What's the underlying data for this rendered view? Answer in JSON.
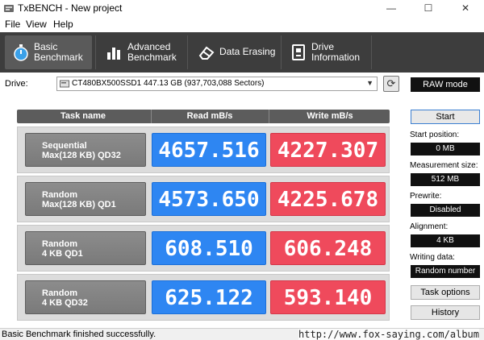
{
  "window": {
    "title": "TxBENCH - New project",
    "minimize": "—",
    "maximize": "☐",
    "close": "✕"
  },
  "menu": [
    "File",
    "View",
    "Help"
  ],
  "tabs": [
    {
      "label": "Basic\nBenchmark",
      "icon": "stopwatch-icon",
      "active": true
    },
    {
      "label": "Advanced\nBenchmark",
      "icon": "bar-chart-icon",
      "active": false
    },
    {
      "label": "Data Erasing",
      "icon": "eraser-icon",
      "active": false
    },
    {
      "label": "Drive\nInformation",
      "icon": "drive-info-icon",
      "active": false
    }
  ],
  "drive": {
    "label": "Drive:",
    "selected": "CT480BX500SSD1  447.13 GB (937,703,088 Sectors)"
  },
  "table": {
    "headers": [
      "Task name",
      "Read mB/s",
      "Write mB/s"
    ],
    "rows": [
      {
        "task_line1": "Sequential",
        "task_line2": "Max(128 KB) QD32",
        "read": "4657.516",
        "write": "4227.307"
      },
      {
        "task_line1": "Random",
        "task_line2": "Max(128 KB) QD1",
        "read": "4573.650",
        "write": "4225.678"
      },
      {
        "task_line1": "Random",
        "task_line2": "4 KB QD1",
        "read": "608.510",
        "write": "606.248"
      },
      {
        "task_line1": "Random",
        "task_line2": "4 KB QD32",
        "read": "625.122",
        "write": "593.140"
      }
    ]
  },
  "panel": {
    "raw_mode": "RAW mode",
    "start": "Start",
    "start_position_label": "Start position:",
    "start_position": "0 MB",
    "measurement_size_label": "Measurement size:",
    "measurement_size": "512 MB",
    "prewrite_label": "Prewrite:",
    "prewrite": "Disabled",
    "alignment_label": "Alignment:",
    "alignment": "4 KB",
    "writing_data_label": "Writing data:",
    "writing_data": "Random number",
    "task_options": "Task options",
    "history": "History"
  },
  "status": {
    "text": "Basic Benchmark finished successfully.",
    "watermark": "http://www.fox-saying.com/album"
  },
  "colors": {
    "toolbar_bg": "#3d3d3d",
    "read_blue": "#2e86f2",
    "write_red": "#ef4a5c",
    "task_gray": "#808080"
  }
}
